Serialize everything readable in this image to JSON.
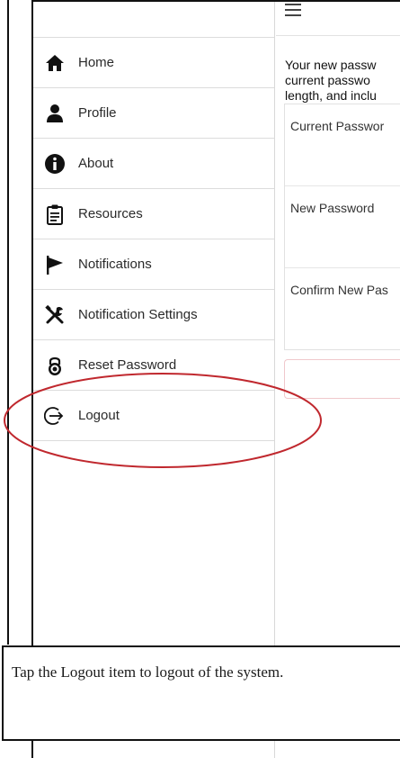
{
  "sidebar": {
    "items": [
      {
        "label": "Home",
        "icon": "home-icon"
      },
      {
        "label": "Profile",
        "icon": "user-icon"
      },
      {
        "label": "About",
        "icon": "info-icon"
      },
      {
        "label": "Resources",
        "icon": "clipboard-icon"
      },
      {
        "label": "Notifications",
        "icon": "flag-icon"
      },
      {
        "label": "Notification Settings",
        "icon": "tools-icon"
      },
      {
        "label": "Reset Password",
        "icon": "padlock-icon"
      },
      {
        "label": "Logout",
        "icon": "logout-icon"
      }
    ]
  },
  "main": {
    "intro_lines": [
      "Your new passw",
      "current passwo",
      "length, and inclu"
    ],
    "fields": [
      "Current Passwor",
      "New Password",
      "Confirm New Pas"
    ]
  },
  "caption": {
    "text": "Tap the Logout item to logout of the system."
  },
  "colors": {
    "highlight": "#c0282e",
    "divider": "#dcdcdc"
  }
}
